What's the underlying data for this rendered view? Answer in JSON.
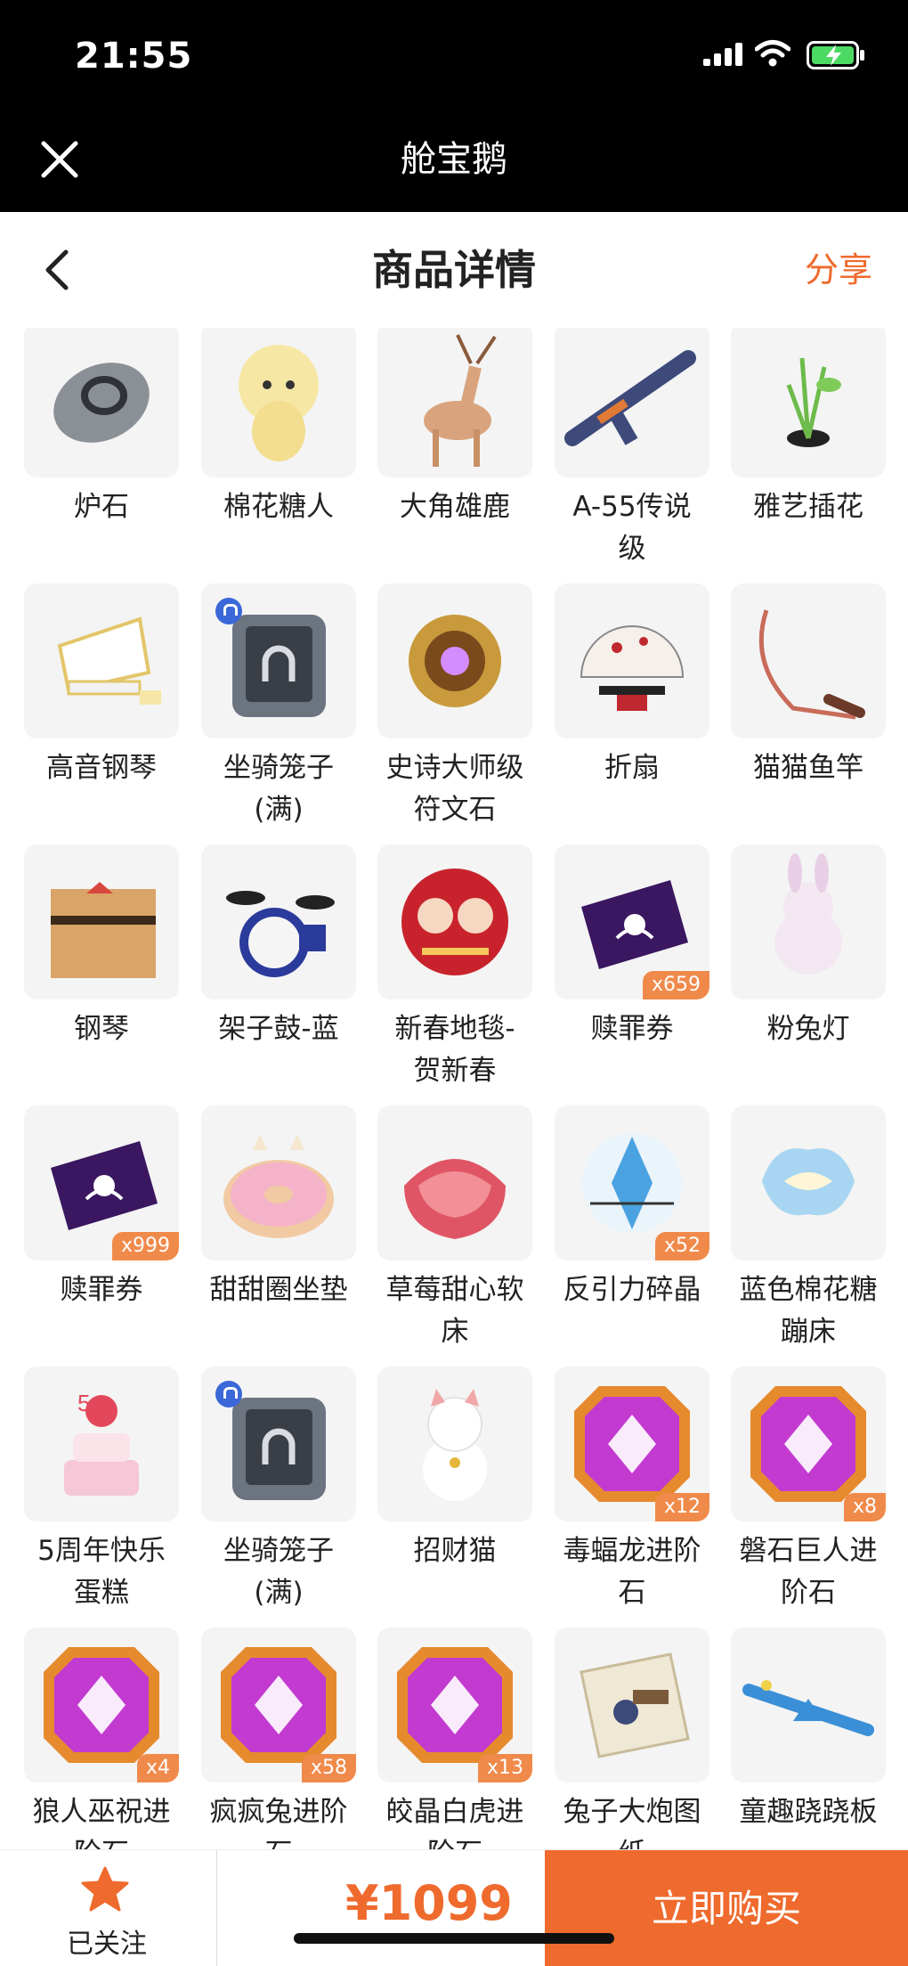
{
  "status": {
    "time": "21:55"
  },
  "app": {
    "title": "舱宝鹅"
  },
  "header": {
    "title": "商品详情",
    "share": "分享"
  },
  "items": [
    {
      "label": "炉石",
      "badge": ""
    },
    {
      "label": "棉花糖人",
      "badge": ""
    },
    {
      "label": "大角雄鹿",
      "badge": ""
    },
    {
      "label": "A-55传说\n级",
      "badge": ""
    },
    {
      "label": "雅艺插花",
      "badge": ""
    },
    {
      "label": "高音钢琴",
      "badge": ""
    },
    {
      "label": "坐骑笼子\n(满)",
      "badge": ""
    },
    {
      "label": "史诗大师级\n符文石",
      "badge": ""
    },
    {
      "label": "折扇",
      "badge": ""
    },
    {
      "label": "猫猫鱼竿",
      "badge": ""
    },
    {
      "label": "钢琴",
      "badge": ""
    },
    {
      "label": "架子鼓-蓝",
      "badge": ""
    },
    {
      "label": "新春地毯-\n贺新春",
      "badge": ""
    },
    {
      "label": "赎罪券",
      "badge": "x659"
    },
    {
      "label": "粉兔灯",
      "badge": ""
    },
    {
      "label": "赎罪券",
      "badge": "x999"
    },
    {
      "label": "甜甜圈坐垫",
      "badge": ""
    },
    {
      "label": "草莓甜心软\n床",
      "badge": ""
    },
    {
      "label": "反引力碎晶",
      "badge": "x52"
    },
    {
      "label": "蓝色棉花糖\n蹦床",
      "badge": ""
    },
    {
      "label": "5周年快乐\n蛋糕",
      "badge": ""
    },
    {
      "label": "坐骑笼子\n(满)",
      "badge": ""
    },
    {
      "label": "招财猫",
      "badge": ""
    },
    {
      "label": "毒蝠龙进阶\n石",
      "badge": "x12"
    },
    {
      "label": "磐石巨人进\n阶石",
      "badge": "x8"
    },
    {
      "label": "狼人巫祝进\n阶石",
      "badge": "x4"
    },
    {
      "label": "疯疯兔进阶\n石",
      "badge": "x58"
    },
    {
      "label": "皎晶白虎进\n阶石",
      "badge": "x13"
    },
    {
      "label": "兔子大炮图\n纸",
      "badge": ""
    },
    {
      "label": "童趣跷跷板",
      "badge": ""
    }
  ],
  "bottom": {
    "follow": "已关注",
    "price": "¥1099",
    "buy": "立即购买"
  },
  "colors": {
    "accent": "#ef6a2d",
    "badge": "#f08a4b"
  }
}
